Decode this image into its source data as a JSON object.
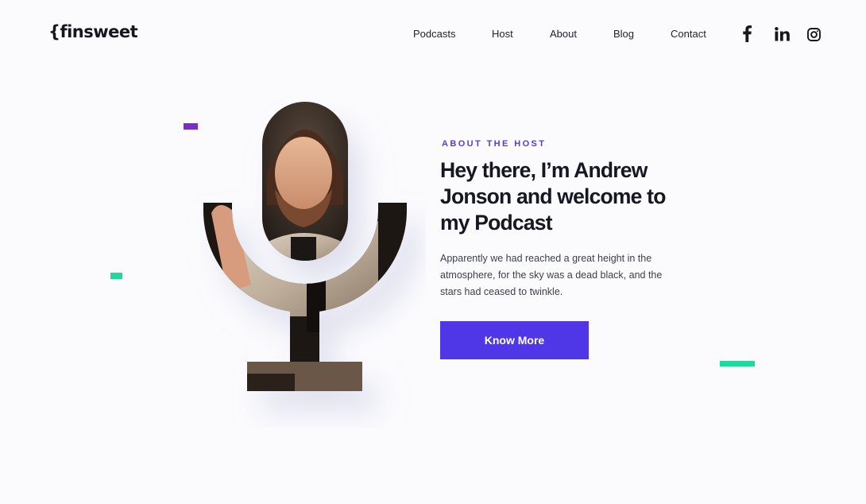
{
  "brand": {
    "logo_text": "{finsweet"
  },
  "nav": {
    "items": [
      {
        "label": "Podcasts"
      },
      {
        "label": "Host"
      },
      {
        "label": "About"
      },
      {
        "label": "Blog"
      },
      {
        "label": "Contact"
      }
    ],
    "social": [
      "facebook-icon",
      "linkedin-icon",
      "instagram-icon"
    ]
  },
  "hero": {
    "eyebrow": "ABOUT THE HOST",
    "headline": "Hey there, I’m Andrew Jonson and welcome to my Podcast",
    "body": "Apparently we had reached a great height in the atmosphere, for the sky was a dead black, and the stars had ceased to twinkle.",
    "cta_label": "Know More"
  },
  "colors": {
    "accent": "#4f36e6",
    "eyebrow": "#5a3bd8",
    "deco_purple": "#7b2ec7",
    "deco_green": "#1ed99b"
  }
}
